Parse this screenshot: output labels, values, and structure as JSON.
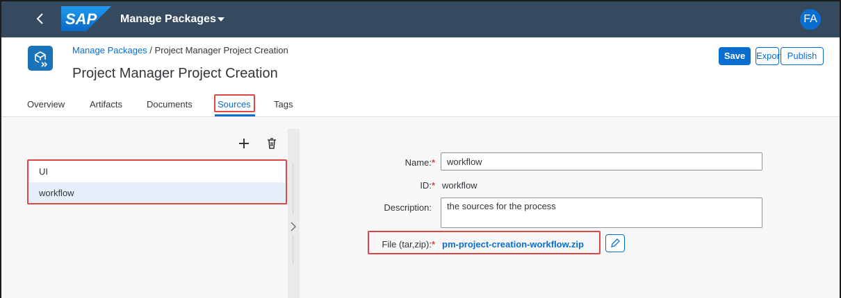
{
  "shell": {
    "app_title": "Manage Packages",
    "logo_text": "SAP",
    "avatar_initials": "FA"
  },
  "header": {
    "breadcrumb_link": "Manage Packages",
    "breadcrumb_separator": " / ",
    "breadcrumb_current": "Project Manager Project Creation",
    "title": "Project Manager Project Creation",
    "actions": {
      "save": "Save",
      "export": "Export",
      "publish": "Publish"
    },
    "tabs": [
      {
        "label": "Overview",
        "selected": false
      },
      {
        "label": "Artifacts",
        "selected": false
      },
      {
        "label": "Documents",
        "selected": false
      },
      {
        "label": "Sources",
        "selected": true
      },
      {
        "label": "Tags",
        "selected": false
      }
    ]
  },
  "sources": {
    "items": [
      {
        "label": "UI",
        "selected": false
      },
      {
        "label": "workflow",
        "selected": true
      }
    ]
  },
  "form": {
    "name_label": "Name:",
    "name_value": "workflow",
    "id_label": "ID:",
    "id_value": "workflow",
    "description_label": "Description:",
    "description_value": "the sources for the process",
    "file_label": "File (tar,zip):",
    "file_value": "pm-project-creation-workflow.zip",
    "required_marker": "*"
  },
  "colors": {
    "shell_bg": "#354a5f",
    "accent": "#0a6ed1",
    "highlight_box": "#e04545",
    "selected_row": "#e5f0fa"
  }
}
